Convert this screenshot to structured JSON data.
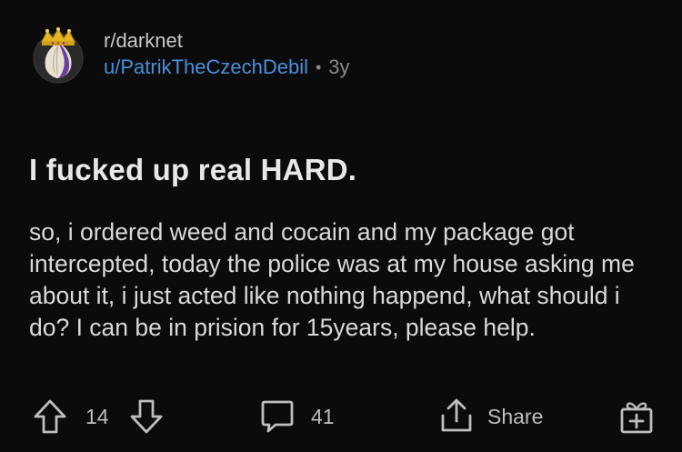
{
  "post": {
    "subreddit": "r/darknet",
    "username": "u/PatrikTheCzechDebil",
    "separator": "•",
    "age": "3y",
    "title": "I fucked up real HARD.",
    "body": "so, i ordered weed and cocain and my package got intercepted, today the police was at my house asking me about it, i just acted like nothing happend, what should i do? I can be in prision for 15years, please help."
  },
  "actions": {
    "vote_count": "14",
    "comment_count": "41",
    "share_label": "Share"
  },
  "icons": {
    "upvote": "arrow-up-icon",
    "downvote": "arrow-down-icon",
    "comments": "comment-bubble-icon",
    "share": "share-icon",
    "award": "gift-icon"
  },
  "colors": {
    "background": "#0b0b0b",
    "username": "#4a8fdc",
    "muted": "#8a8a8a",
    "text": "#d9d9d9"
  }
}
